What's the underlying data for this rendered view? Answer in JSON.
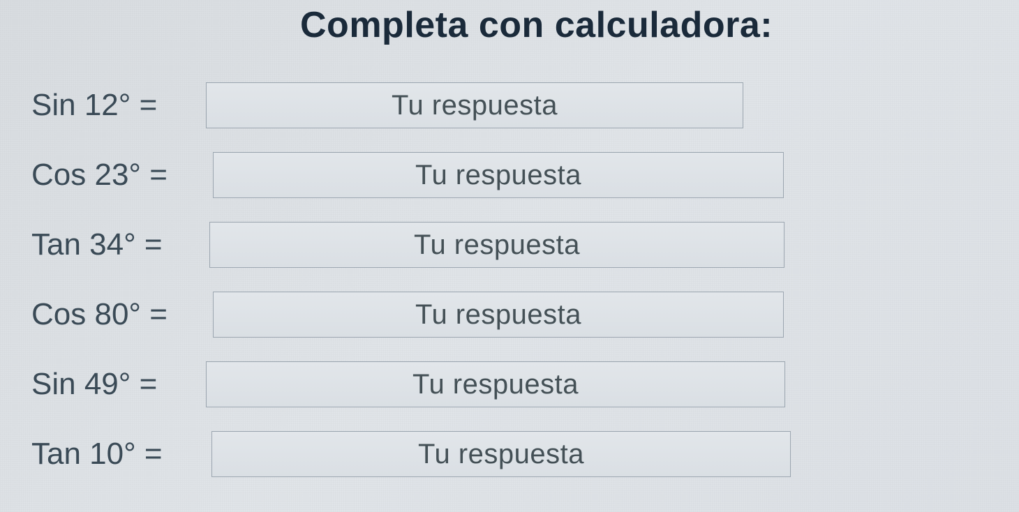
{
  "heading": "Completa con calculadora:",
  "placeholder": "Tu respuesta",
  "rows": [
    {
      "label": "Sin 12° ="
    },
    {
      "label": "Cos 23° ="
    },
    {
      "label": "Tan 34° ="
    },
    {
      "label": "Cos 80° ="
    },
    {
      "label": "Sin 49° ="
    },
    {
      "label": "Tan 10° ="
    }
  ]
}
